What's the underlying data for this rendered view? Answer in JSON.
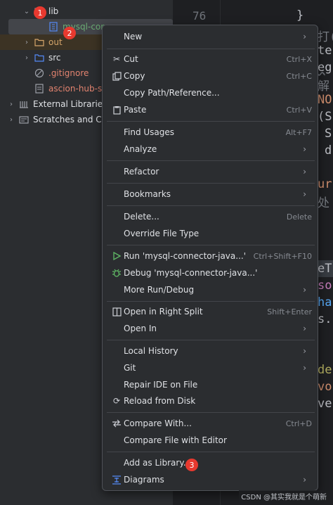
{
  "tree": {
    "items": [
      {
        "label": "lib",
        "color": "#dfe1e5"
      },
      {
        "label": "mysql-conn",
        "color": "#6aab73"
      },
      {
        "label": "out",
        "color": "#d5a56a"
      },
      {
        "label": "src",
        "color": "#dfe1e5"
      },
      {
        "label": ".gitignore",
        "color": "#e2836f"
      },
      {
        "label": "ascion-hub-ser",
        "color": "#e2836f"
      },
      {
        "label": "External Libraries",
        "color": "#dfe1e5"
      },
      {
        "label": "Scratches and Con",
        "color": "#dfe1e5"
      }
    ]
  },
  "editor": {
    "line_number": "76",
    "brace": "}",
    "fragments": [
      "打(",
      "te",
      "eg",
      "解",
      "NO",
      "(S",
      "S",
      "d",
      "ur",
      "处",
      "eT",
      "so",
      "ha",
      "s.",
      "de",
      "vo",
      "ve"
    ]
  },
  "menu": {
    "items": [
      {
        "label": "New",
        "shortcut": "",
        "submenu": true,
        "icon": ""
      },
      {
        "label": "Cut",
        "shortcut": "Ctrl+X",
        "submenu": false,
        "icon": "cut-icon"
      },
      {
        "label": "Copy",
        "shortcut": "Ctrl+C",
        "submenu": false,
        "icon": "copy-icon"
      },
      {
        "label": "Copy Path/Reference...",
        "shortcut": "",
        "submenu": false,
        "icon": ""
      },
      {
        "label": "Paste",
        "shortcut": "Ctrl+V",
        "submenu": false,
        "icon": "paste-icon"
      },
      {
        "label": "Find Usages",
        "shortcut": "Alt+F7",
        "submenu": false,
        "icon": ""
      },
      {
        "label": "Analyze",
        "shortcut": "",
        "submenu": true,
        "icon": ""
      },
      {
        "label": "Refactor",
        "shortcut": "",
        "submenu": true,
        "icon": ""
      },
      {
        "label": "Bookmarks",
        "shortcut": "",
        "submenu": true,
        "icon": ""
      },
      {
        "label": "Delete...",
        "shortcut": "Delete",
        "submenu": false,
        "icon": ""
      },
      {
        "label": "Override File Type",
        "shortcut": "",
        "submenu": false,
        "icon": ""
      },
      {
        "label": "Run 'mysql-connector-java...'",
        "shortcut": "Ctrl+Shift+F10",
        "submenu": false,
        "icon": "run-icon"
      },
      {
        "label": "Debug 'mysql-connector-java...'",
        "shortcut": "",
        "submenu": false,
        "icon": "debug-icon"
      },
      {
        "label": "More Run/Debug",
        "shortcut": "",
        "submenu": true,
        "icon": ""
      },
      {
        "label": "Open in Right Split",
        "shortcut": "Shift+Enter",
        "submenu": false,
        "icon": "split-icon"
      },
      {
        "label": "Open In",
        "shortcut": "",
        "submenu": true,
        "icon": ""
      },
      {
        "label": "Local History",
        "shortcut": "",
        "submenu": true,
        "icon": ""
      },
      {
        "label": "Git",
        "shortcut": "",
        "submenu": true,
        "icon": ""
      },
      {
        "label": "Repair IDE on File",
        "shortcut": "",
        "submenu": false,
        "icon": ""
      },
      {
        "label": "Reload from Disk",
        "shortcut": "",
        "submenu": false,
        "icon": "reload-icon"
      },
      {
        "label": "Compare With...",
        "shortcut": "Ctrl+D",
        "submenu": false,
        "icon": "compare-icon"
      },
      {
        "label": "Compare File with Editor",
        "shortcut": "",
        "submenu": false,
        "icon": ""
      },
      {
        "label": "Add as Library...",
        "shortcut": "",
        "submenu": false,
        "icon": ""
      },
      {
        "label": "Diagrams",
        "shortcut": "",
        "submenu": true,
        "icon": "diagrams-icon"
      }
    ]
  },
  "badges": [
    "1",
    "2",
    "3"
  ],
  "watermark": "CSDN @其实我就是个萌新"
}
